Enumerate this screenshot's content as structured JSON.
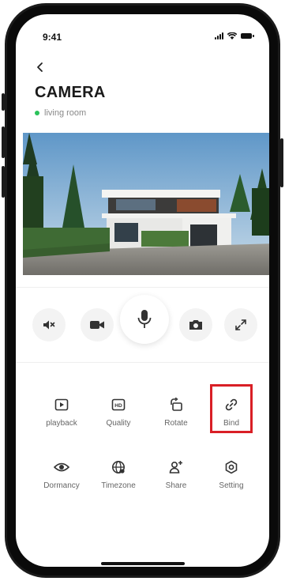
{
  "status_bar": {
    "time": "9:41"
  },
  "header": {
    "title": "CAMERA",
    "location": "living room"
  },
  "colors": {
    "online": "#2bc25a",
    "highlight": "#d91f26",
    "control_bg": "#f3f3f3"
  },
  "controls": [
    {
      "name": "mute",
      "icon": "speaker-mute-icon"
    },
    {
      "name": "record",
      "icon": "video-camera-icon"
    },
    {
      "name": "talk",
      "icon": "microphone-icon"
    },
    {
      "name": "snapshot",
      "icon": "camera-icon"
    },
    {
      "name": "fullscreen",
      "icon": "expand-icon"
    }
  ],
  "features": {
    "playback": "playback",
    "quality": "Quality",
    "rotate": "Rotate",
    "bind": "Bind",
    "dormancy": "Dormancy",
    "timezone": "Timezone",
    "share": "Share",
    "setting": "Setting"
  }
}
